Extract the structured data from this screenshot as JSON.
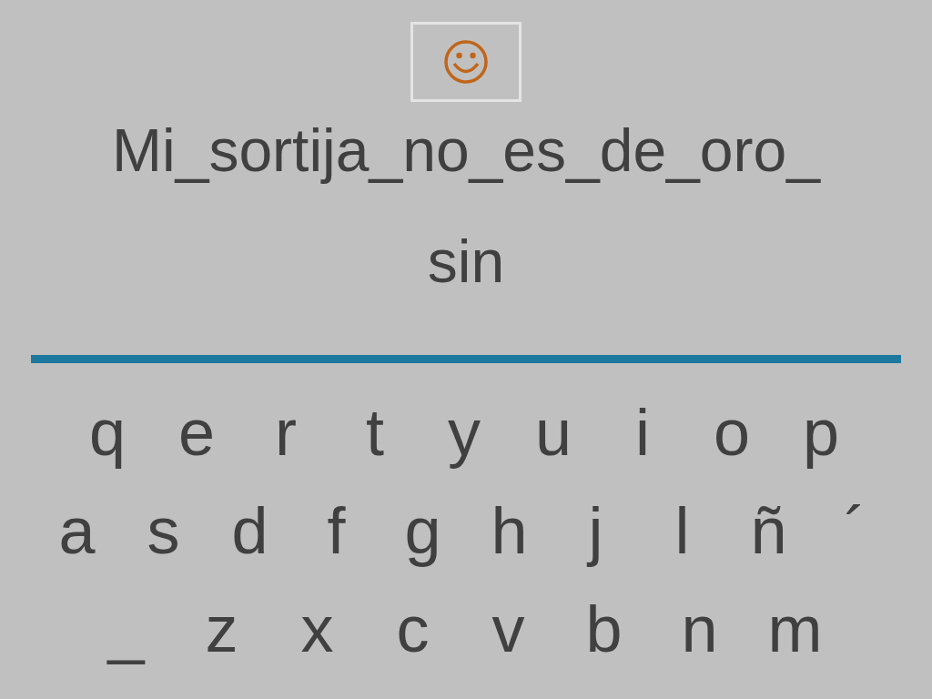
{
  "smiley_button": {
    "kind": "smiley"
  },
  "prompt": {
    "lines": [
      "Mi_sortija_no_es_de_oro_",
      "sin"
    ]
  },
  "keyboard": {
    "rows": [
      [
        "q",
        "e",
        "r",
        "t",
        "y",
        "u",
        "i",
        "o",
        "p"
      ],
      [
        "a",
        "s",
        "d",
        "f",
        "g",
        "h",
        "j",
        "l",
        "ñ",
        "´"
      ],
      [
        "_",
        "z",
        "x",
        "c",
        "v",
        "b",
        "n",
        "m"
      ]
    ]
  }
}
